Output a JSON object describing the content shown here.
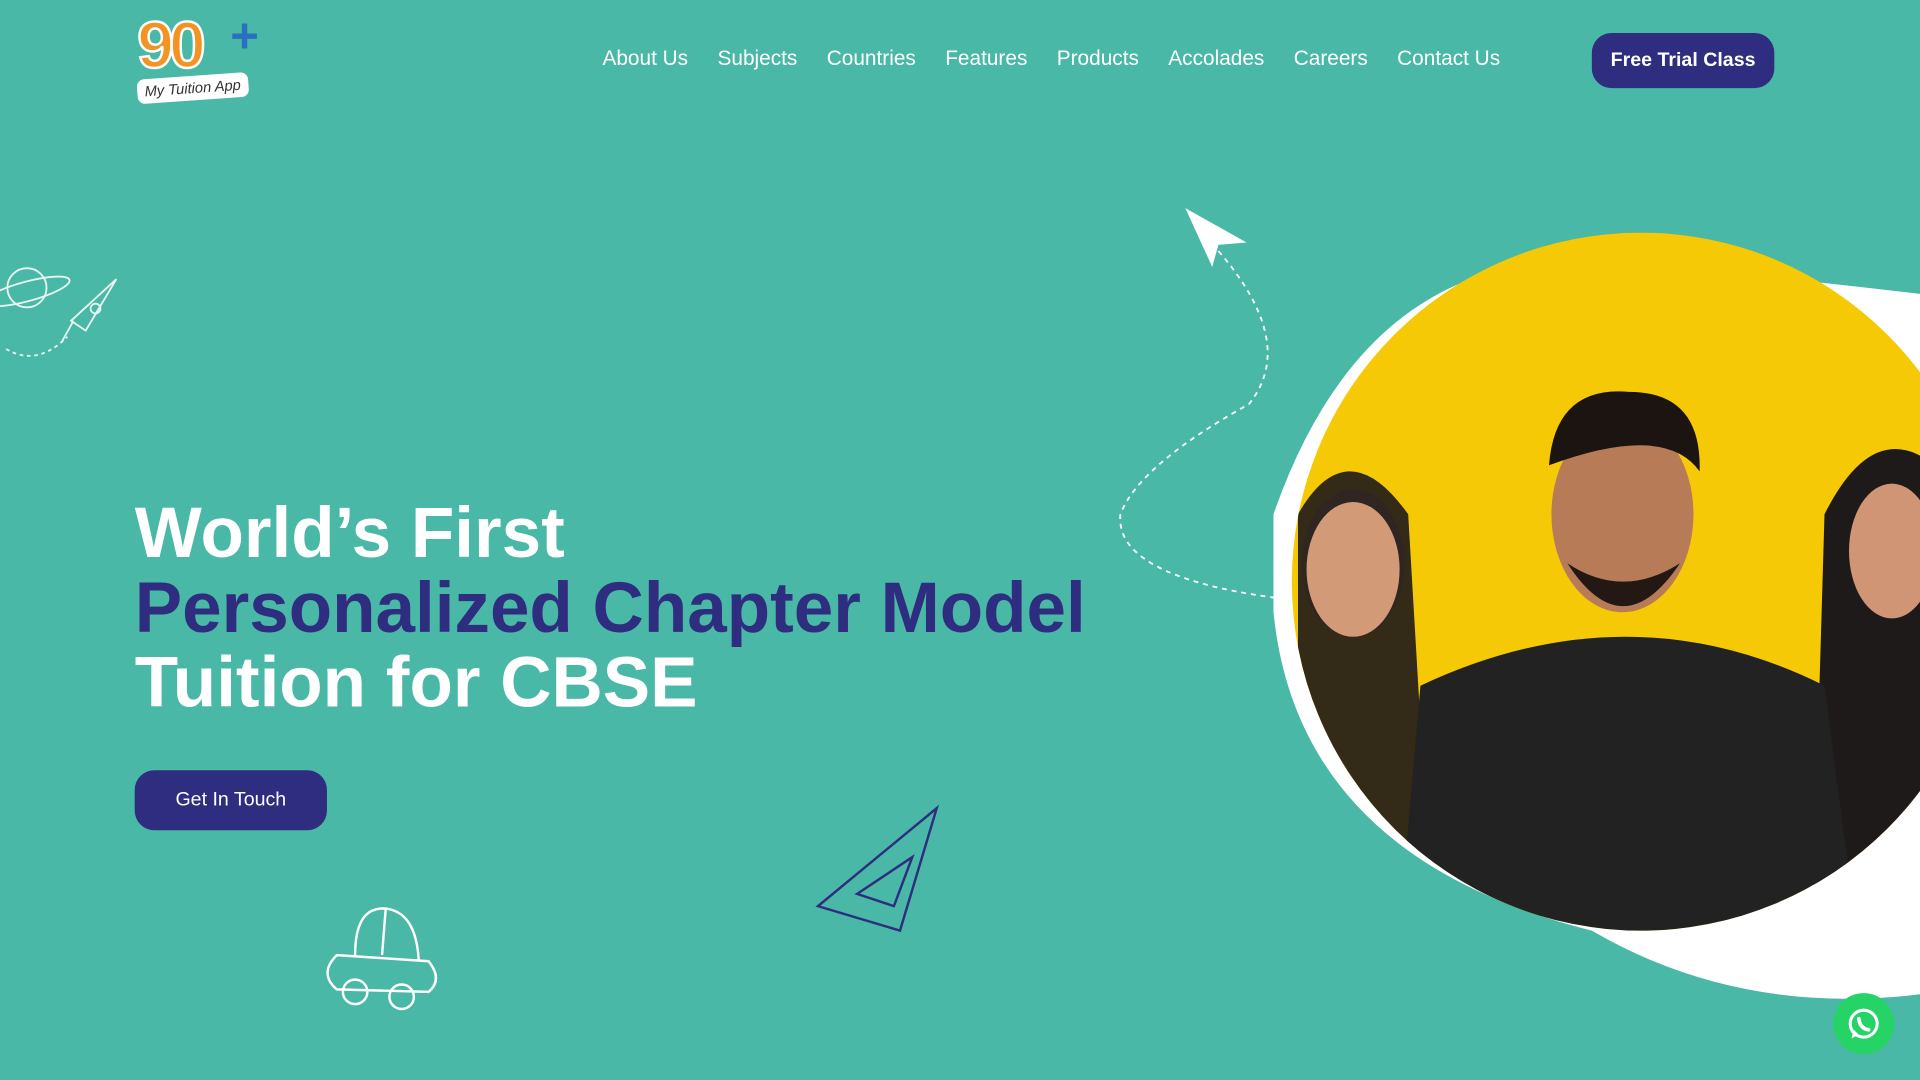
{
  "brand": {
    "logo_number": "90",
    "logo_plus": "+",
    "logo_tagline": "My Tuition App"
  },
  "nav": {
    "items": [
      "About Us",
      "Subjects",
      "Countries",
      "Features",
      "Products",
      "Accolades",
      "Careers",
      "Contact Us"
    ],
    "cta": "Free Trial Class"
  },
  "hero": {
    "line1": "World’s First",
    "line2": "Personalized Chapter Model",
    "line3": "Tuition for CBSE",
    "button": "Get In Touch"
  },
  "colors": {
    "background": "#4ab8a7",
    "accent": "#2e2d7f",
    "photo_bg": "#f5c906",
    "whatsapp": "#25d366"
  }
}
